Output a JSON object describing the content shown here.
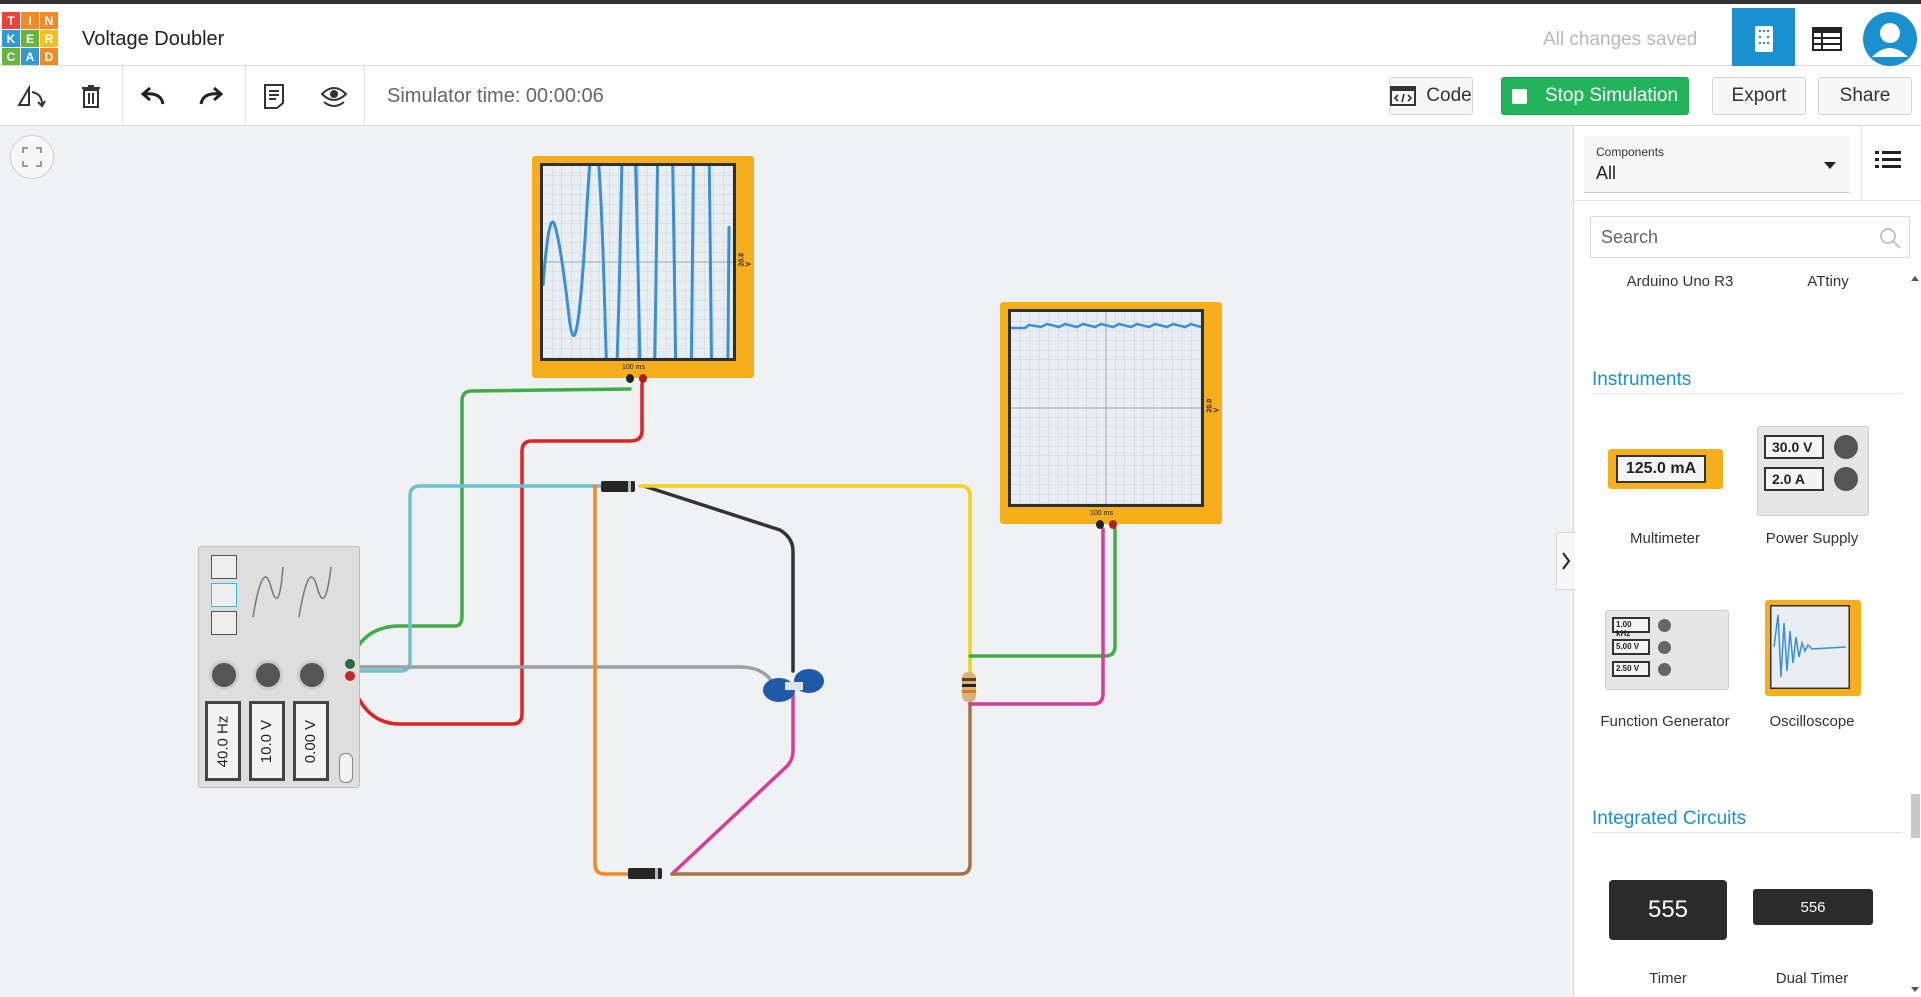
{
  "logo": {
    "letters": [
      "T",
      "I",
      "N",
      "K",
      "E",
      "R",
      "C",
      "A",
      "D"
    ],
    "colors": [
      "#e8443a",
      "#f28b27",
      "#f28b27",
      "#2e9bd6",
      "#2e9bd6",
      "#f5c11c",
      "#2e9bd6",
      "#2e9bd6",
      "#2e9bd6"
    ]
  },
  "header": {
    "title": "Voltage Doubler",
    "status": "All changes saved"
  },
  "toolbar": {
    "sim_time": "Simulator time: 00:00:06",
    "code_label": "Code",
    "stop_label": "Stop Simulation",
    "export_label": "Export",
    "share_label": "Share"
  },
  "canvas": {
    "osc1_timebase": "100 ms",
    "osc1_scale": "20.0 V",
    "osc2_timebase": "100 ms",
    "osc2_scale": "20.0 V",
    "fg_freq": "40.0 Hz",
    "fg_amp": "10.0 V",
    "fg_offset": "0.00 V"
  },
  "panel": {
    "components_label": "Components",
    "components_value": "All",
    "search_placeholder": "Search",
    "top_items": [
      "Arduino Uno R3",
      "ATtiny"
    ],
    "instruments_title": "Instruments",
    "multimeter_reading": "125.0 mA",
    "power_v": "30.0 V",
    "power_a": "2.0 A",
    "fg_thumb_freq": "1.00 kHz",
    "fg_thumb_amp": "5.00 V",
    "fg_thumb_offset": "2.50 V",
    "items": [
      "Multimeter",
      "Power Supply",
      "Function Generator",
      "Oscilloscope"
    ],
    "ic_title": "Integrated Circuits",
    "ic_555": "555",
    "ic_556": "556",
    "ic_items": [
      "Timer",
      "Dual Timer"
    ]
  },
  "colors": {
    "accent": "#1a90d0",
    "stop": "#23b35a",
    "scope": "#f6ae1c"
  }
}
